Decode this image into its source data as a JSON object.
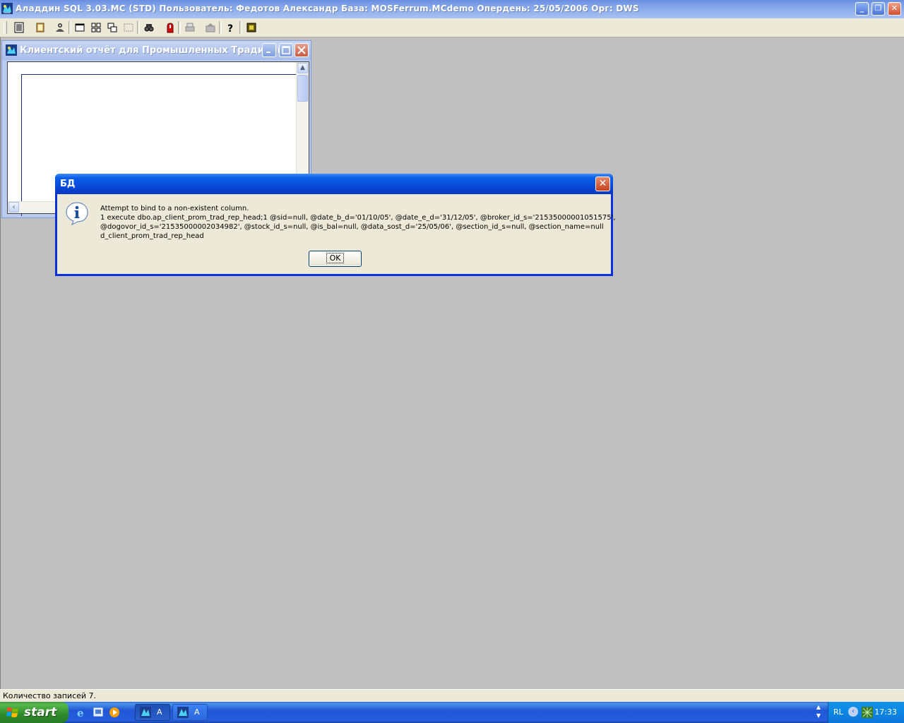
{
  "app": {
    "title": "Аладдин SQL 3.03.MC (STD)  Пользователь: Федотов Александр База: MOSFerrum.MCdemo Опердень: 25/05/2006 Орг: DWS",
    "window_buttons": [
      "minimize-icon",
      "restore-icon",
      "close-icon"
    ]
  },
  "toolbar": {
    "buttons": [
      "report-icon",
      "database-icon",
      "user-icon",
      "window-icon",
      "tile-icon",
      "cascade-icon",
      "arrange-icon",
      "find-icon",
      "stop-icon",
      "print-icon",
      "export-icon",
      "help-icon",
      "exit-icon"
    ]
  },
  "child_window": {
    "title": "Клиентский отчёт для Промышленных Традиций"
  },
  "dialog": {
    "title": "БД",
    "message_lines": [
      "Attempt to bind to a non-existent column.",
      "1 execute dbo.ap_client_prom_trad_rep_head;1 @sid=null, @date_b_d='01/10/05', @date_e_d='31/12/05', @broker_id_s='21535000001051575',",
      "@dogovor_id_s='21535000002034982', @stock_id_s=null, @is_bal=null, @data_sost_d='25/05/06', @section_id_s=null, @section_name=null",
      "d_client_prom_trad_rep_head"
    ],
    "ok_label": "OK",
    "icon": "information-icon"
  },
  "statusbar": {
    "text": "Количество записей 7."
  },
  "taskbar": {
    "start_label": "start",
    "tasks": [
      {
        "label": "A",
        "active": true
      },
      {
        "label": "A",
        "active": false
      }
    ],
    "tray": {
      "language": "RL",
      "time": "17:33"
    }
  }
}
